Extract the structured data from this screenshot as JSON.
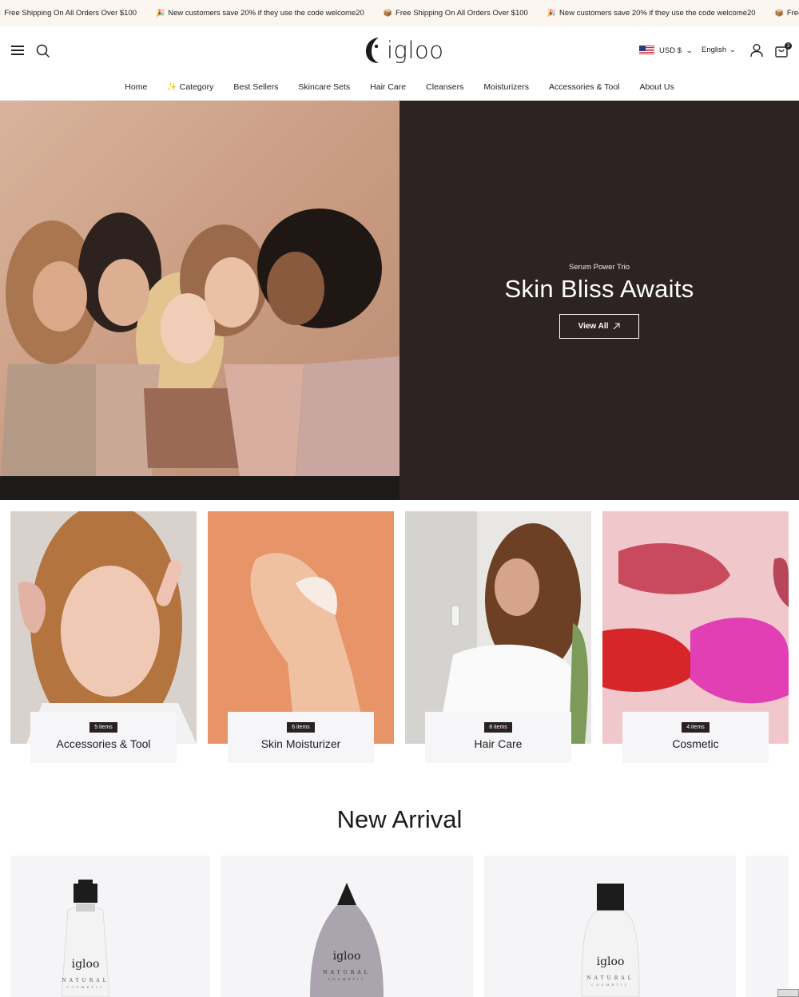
{
  "announcement": {
    "items": [
      {
        "icon": "package-icon",
        "glyph": "📦",
        "text": "Free Shipping On All Orders Over $100"
      },
      {
        "icon": "party-icon",
        "glyph": "🎉",
        "text": "New customers save 20% if they use the code welcome20"
      },
      {
        "icon": "package-icon",
        "glyph": "📦",
        "text": "Free Shipping On All Orders Over $100"
      },
      {
        "icon": "party-icon",
        "glyph": "🎉",
        "text": "New customers save 20% if they use the code welcome20"
      },
      {
        "icon": "package-icon",
        "glyph": "📦",
        "text": "Free Sh"
      }
    ]
  },
  "header": {
    "logo_text": "igloo",
    "currency": "USD $",
    "language": "English",
    "cart_count": "3"
  },
  "nav": {
    "items": [
      "Home",
      "Category",
      "Best Sellers",
      "Skincare Sets",
      "Hair Care",
      "Cleansers",
      "Moisturizers",
      "Accessories & Tool",
      "About Us"
    ]
  },
  "hero": {
    "subtitle": "Serum Power Trio",
    "title": "Skin Bliss Awaits",
    "button": "View All"
  },
  "categories": [
    {
      "count": "5 items",
      "name": "Accessories & Tool"
    },
    {
      "count": "6 items",
      "name": "Skin Moisturizer"
    },
    {
      "count": "8 items",
      "name": "Hair Care"
    },
    {
      "count": "4 items",
      "name": "Cosmetic"
    }
  ],
  "new_arrival": {
    "title": "New Arrival",
    "products": [
      {
        "brand": "igloo",
        "label": "NATURAL",
        "sublabel": "COSMETIC"
      },
      {
        "brand": "igloo",
        "label": "NATURAL",
        "sublabel": "COSMETIC"
      },
      {
        "brand": "igloo",
        "label": "NATURAL",
        "sublabel": "COSMETIC"
      }
    ]
  },
  "colors": {
    "announcement_bg": "#fbf6ef",
    "hero_panel": "#2d2323",
    "card_bg": "#f6f6f9",
    "badge_bg": "#2a2222"
  }
}
